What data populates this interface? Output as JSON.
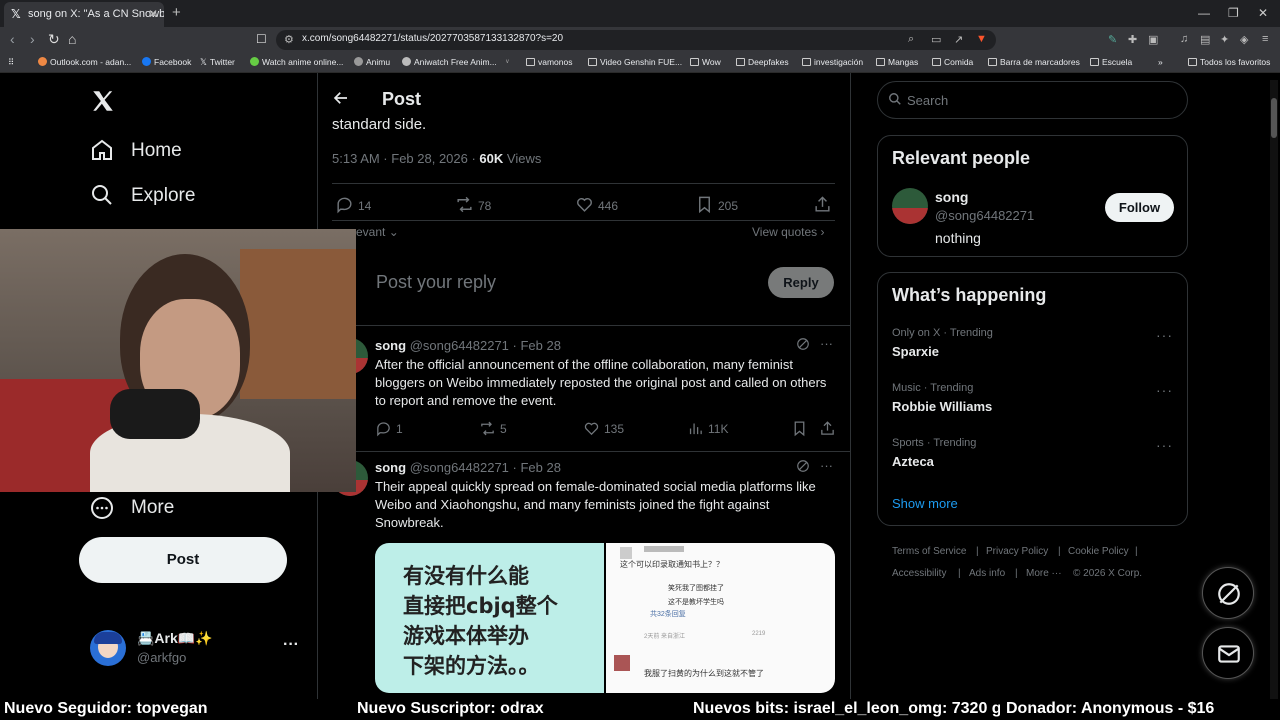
{
  "browser": {
    "tab_title": "song on X: \"As a CN Snowbreak...",
    "url": "x.com/song64482271/status/2027703587133132870?s=20",
    "bookmarks": [
      "Outlook.com - adan...",
      "Facebook",
      "Twitter",
      "Watch anime online...",
      "Animu",
      "Aniwatch Free Anim...",
      "vamonos",
      "Video Genshin FUE...",
      "Wow",
      "Deepfakes",
      "investigación",
      "Mangas",
      "Comida",
      "Barra de marcadores",
      "Escuela"
    ],
    "bookmarks_more": "»",
    "all_bookmarks": "Todos los favoritos"
  },
  "nav": {
    "items": [
      {
        "label": "Home",
        "icon": "home-icon"
      },
      {
        "label": "Explore",
        "icon": "search-icon"
      },
      {
        "label": "More",
        "icon": "more-circle-icon"
      }
    ],
    "post_button": "Post",
    "account": {
      "name": "📇Ark📖✨",
      "handle": "@arkfgo"
    }
  },
  "header": {
    "title": "Post"
  },
  "main_post": {
    "text_tail": "standard side.",
    "time": "5:13 AM · Feb 28, 2026 · ",
    "views_count": "60K",
    "views_label": " Views",
    "replies": "14",
    "reposts": "78",
    "likes": "446",
    "bookmarks": "205"
  },
  "sort": {
    "label": "evant",
    "view_quotes": "View quotes"
  },
  "reply_box": {
    "placeholder": "Post your reply",
    "button": "Reply"
  },
  "replies": [
    {
      "name": "song",
      "meta": "@song64482271 · Feb 28",
      "text": "After the official announcement of the offline collaboration, many feminist bloggers on Weibo immediately reposted the original post and called on others to report and remove the event.",
      "replies": "1",
      "reposts": "5",
      "likes": "135",
      "views": "11K"
    },
    {
      "name": "song",
      "meta": "@song64482271 · Feb 28",
      "text": "Their appeal quickly spread on female-dominated social media platforms like Weibo and Xiaohongshu, and many feminists joined the fight against Snowbreak."
    }
  ],
  "image_left": {
    "lines": [
      "有没有什么能",
      "直接把cbjq整个",
      "游戏本体举办",
      "下架的方法。。"
    ]
  },
  "image_right": {
    "q": "这个可以印录取通知书上？？",
    "a1": "笑死我了图都挂了",
    "a2": "这不是教坏学生吗",
    "count": "共32条回复",
    "meta": "2天前  来自浙江",
    "likes": "2219",
    "bottom": "我服了扫黄的为什么到这就不管了"
  },
  "search": {
    "placeholder": "Search"
  },
  "relevant": {
    "title": "Relevant people",
    "name": "song",
    "handle": "@song64482271",
    "bio": "nothing",
    "follow": "Follow"
  },
  "happening": {
    "title": "What’s happening",
    "trends": [
      {
        "meta": "Only on X · Trending",
        "name": "Sparxie"
      },
      {
        "meta": "Music · Trending",
        "name": "Robbie Williams"
      },
      {
        "meta": "Sports · Trending",
        "name": "Azteca"
      }
    ],
    "show_more": "Show more"
  },
  "footer": {
    "terms": "Terms of Service",
    "privacy": "Privacy Policy",
    "cookie": "Cookie Policy",
    "accessibility": "Accessibility",
    "ads": "Ads info",
    "more": "More ···",
    "copyright": "© 2026 X Corp."
  },
  "ticker": {
    "follower": "Nuevo Seguidor: topvegan",
    "subscriber": "Nuevo Suscriptor: odrax",
    "bits": "Nuevos bits: israel_el_leon_omg: 7320 gx",
    "donor": "Donador: Anonymous - $16"
  },
  "colors": {
    "accent": "#1d9bf0",
    "bg": "#000000",
    "text": "#e7e9ea",
    "muted": "#71767b",
    "border": "#2f3336"
  }
}
